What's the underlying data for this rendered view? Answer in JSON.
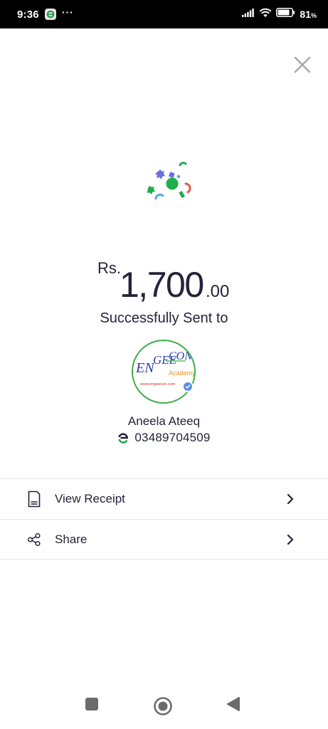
{
  "status_bar": {
    "time": "9:36",
    "overflow": "···",
    "battery_percent": "81",
    "battery_unit": "%",
    "icons": [
      "easypaisa-app-icon",
      "signal-icon",
      "wifi-icon",
      "battery-icon"
    ]
  },
  "close": {
    "icon": "close-icon"
  },
  "transaction": {
    "currency": "Rs.",
    "amount_whole": "1,700",
    "amount_decimal": ".00",
    "status_text": "Successfully Sent to"
  },
  "recipient": {
    "name": "Aneela Ateeq",
    "phone": "03489704509",
    "avatar_logo": {
      "brand_left": "EN",
      "brand_mid": "GEE",
      "brand_right": "CON",
      "subtitle": "Academy",
      "url": "www.engeecon.com"
    }
  },
  "actions": [
    {
      "label": "View Receipt",
      "icon": "receipt-icon"
    },
    {
      "label": "Share",
      "icon": "share-icon"
    }
  ],
  "colors": {
    "brand_green": "#3fae49",
    "text_dark": "#23243a",
    "divider": "#e6e6ea"
  }
}
